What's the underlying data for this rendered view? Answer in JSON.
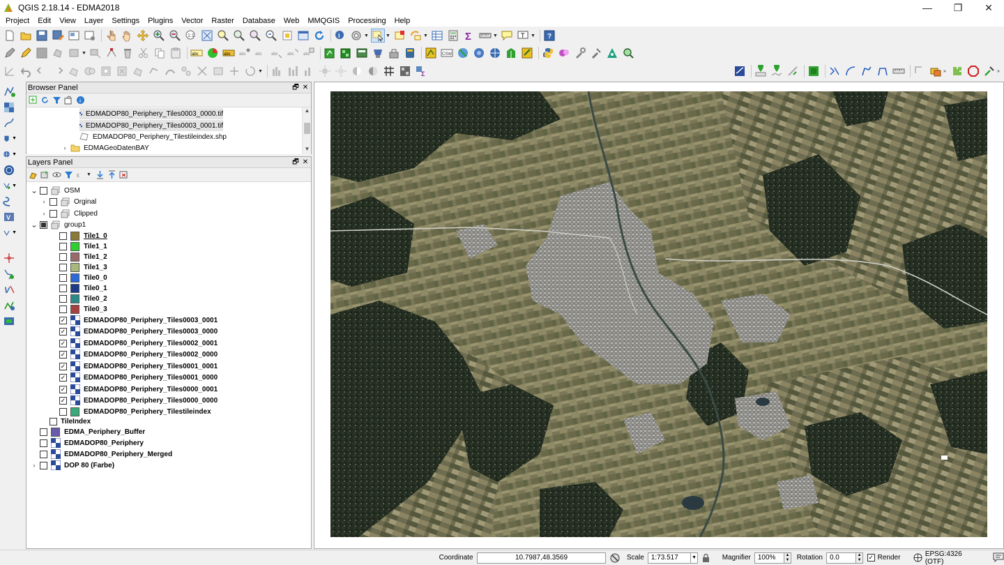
{
  "window": {
    "title": "QGIS 2.18.14 - EDMA2018",
    "minimize": "—",
    "maximize": "❐",
    "close": "✕"
  },
  "menubar": {
    "items": [
      "Project",
      "Edit",
      "View",
      "Layer",
      "Settings",
      "Plugins",
      "Vector",
      "Raster",
      "Database",
      "Web",
      "MMQGIS",
      "Processing",
      "Help"
    ]
  },
  "browser": {
    "title": "Browser Panel",
    "float": "🗗",
    "close": "✕",
    "items": [
      {
        "label": "EDMADOP80_Periphery_Tiles0003_0000.tif",
        "icon": "raster-icon"
      },
      {
        "label": "EDMADOP80_Periphery_Tiles0003_0001.tif",
        "icon": "raster-icon"
      },
      {
        "label": "EDMADOP80_Periphery_Tilestileindex.shp",
        "icon": "polygon-file-icon"
      },
      {
        "label": "EDMAGeoDatenBAY",
        "icon": "folder-icon"
      }
    ]
  },
  "layers": {
    "title": "Layers Panel",
    "float": "🗗",
    "close": "✕",
    "items": [
      {
        "label": "OSM",
        "type": "group",
        "checked": false,
        "expanded": true,
        "bold": false
      },
      {
        "label": "Orginal",
        "type": "group",
        "checked": false,
        "expanded": false,
        "bold": false
      },
      {
        "label": "Clipped",
        "type": "group",
        "checked": false,
        "expanded": false,
        "bold": false
      },
      {
        "label": "group1",
        "type": "group",
        "checked": "partial",
        "expanded": true,
        "bold": false
      },
      {
        "label": "Tile1_0",
        "type": "vector",
        "color": "#8a7a3a",
        "checked": false,
        "bold": true,
        "underline": true
      },
      {
        "label": "Tile1_1",
        "type": "vector",
        "color": "#2fcf2f",
        "checked": false,
        "bold": true
      },
      {
        "label": "Tile1_2",
        "type": "vector",
        "color": "#9a6a6a",
        "checked": false,
        "bold": true
      },
      {
        "label": "Tile1_3",
        "type": "vector",
        "color": "#a8b87a",
        "checked": false,
        "bold": true
      },
      {
        "label": "Tile0_0",
        "type": "vector",
        "color": "#2a6ad8",
        "checked": false,
        "bold": true
      },
      {
        "label": "Tile0_1",
        "type": "vector",
        "color": "#1e3a8a",
        "checked": false,
        "bold": true
      },
      {
        "label": "Tile0_2",
        "type": "vector",
        "color": "#2a8a8a",
        "checked": false,
        "bold": true
      },
      {
        "label": "Tile0_3",
        "type": "vector",
        "color": "#a84040",
        "checked": false,
        "bold": true
      },
      {
        "label": "EDMADOP80_Periphery_Tiles0003_0001",
        "type": "raster",
        "checked": true,
        "bold": true
      },
      {
        "label": "EDMADOP80_Periphery_Tiles0003_0000",
        "type": "raster",
        "checked": true,
        "bold": true
      },
      {
        "label": "EDMADOP80_Periphery_Tiles0002_0001",
        "type": "raster",
        "checked": true,
        "bold": true
      },
      {
        "label": "EDMADOP80_Periphery_Tiles0002_0000",
        "type": "raster",
        "checked": true,
        "bold": true
      },
      {
        "label": "EDMADOP80_Periphery_Tiles0001_0001",
        "type": "raster",
        "checked": true,
        "bold": true
      },
      {
        "label": "EDMADOP80_Periphery_Tiles0001_0000",
        "type": "raster",
        "checked": true,
        "bold": true
      },
      {
        "label": "EDMADOP80_Periphery_Tiles0000_0001",
        "type": "raster",
        "checked": true,
        "bold": true
      },
      {
        "label": "EDMADOP80_Periphery_Tiles0000_0000",
        "type": "raster",
        "checked": true,
        "bold": true
      },
      {
        "label": "EDMADOP80_Periphery_Tilestileindex",
        "type": "vector",
        "color": "#3aaa7a",
        "checked": false,
        "bold": true
      },
      {
        "label": "TileIndex",
        "type": "none",
        "checked": false,
        "bold": true
      },
      {
        "label": "EDMA_Periphery_Buffer",
        "type": "vector",
        "color": "#6a5aaa",
        "checked": false,
        "bold": true
      },
      {
        "label": "EDMADOP80_Periphery",
        "type": "raster",
        "checked": false,
        "bold": true
      },
      {
        "label": "EDMADOP80_Periphery_Merged",
        "type": "raster",
        "checked": false,
        "bold": true
      },
      {
        "label": "DOP 80 (Farbe)",
        "type": "raster",
        "checked": false,
        "bold": true,
        "expandable": true
      }
    ]
  },
  "statusbar": {
    "coordinate_label": "Coordinate",
    "coordinate_value": "10.7987,48.3569",
    "scale_label": "Scale",
    "scale_value": "1:73.517",
    "magnifier_label": "Magnifier",
    "magnifier_value": "100%",
    "rotation_label": "Rotation",
    "rotation_value": "0.0",
    "render_label": "Render",
    "render_checked": true,
    "crs_label": "EPSG:4326 (OTF)"
  },
  "colors": {
    "map_bg": "#4a5a3a",
    "forest": "#263024",
    "urban": "#9a9a98",
    "field_light": "#8a8460",
    "field_dark": "#5a5a40"
  }
}
